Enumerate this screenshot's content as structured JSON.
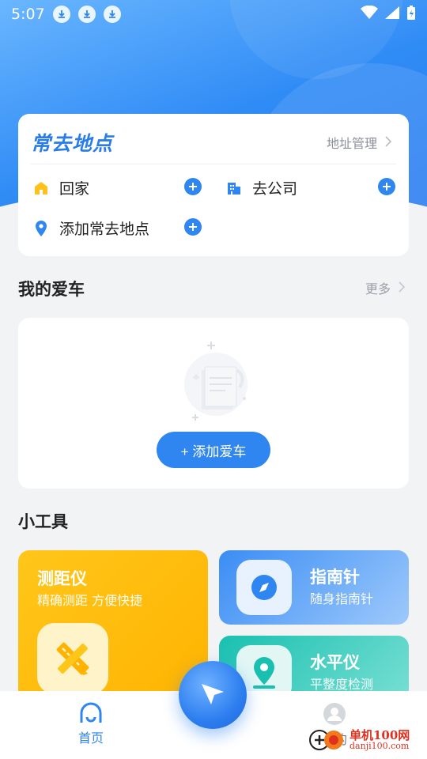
{
  "status_bar": {
    "time": "5:07"
  },
  "frequent_places": {
    "title": "常去地点",
    "manage_label": "地址管理",
    "items": [
      {
        "label": "回家"
      },
      {
        "label": "去公司"
      },
      {
        "label": "添加常去地点"
      }
    ]
  },
  "my_cars": {
    "title": "我的爱车",
    "more_label": "更多",
    "add_button_label": "+ 添加爱车"
  },
  "tools": {
    "title": "小工具",
    "items": [
      {
        "name": "测距仪",
        "desc": "精确测距 方便快捷"
      },
      {
        "name": "指南针",
        "desc": "随身指南针"
      },
      {
        "name": "水平仪",
        "desc": "平整度检测"
      }
    ]
  },
  "tabbar": {
    "home_label": "首页",
    "mine_label": "我的"
  },
  "watermark": {
    "cn": "单机100网",
    "en": "danji100.com"
  },
  "colors": {
    "primary": "#2f86f0",
    "ranger": "#ffc61a",
    "level": "#19c0b0"
  }
}
